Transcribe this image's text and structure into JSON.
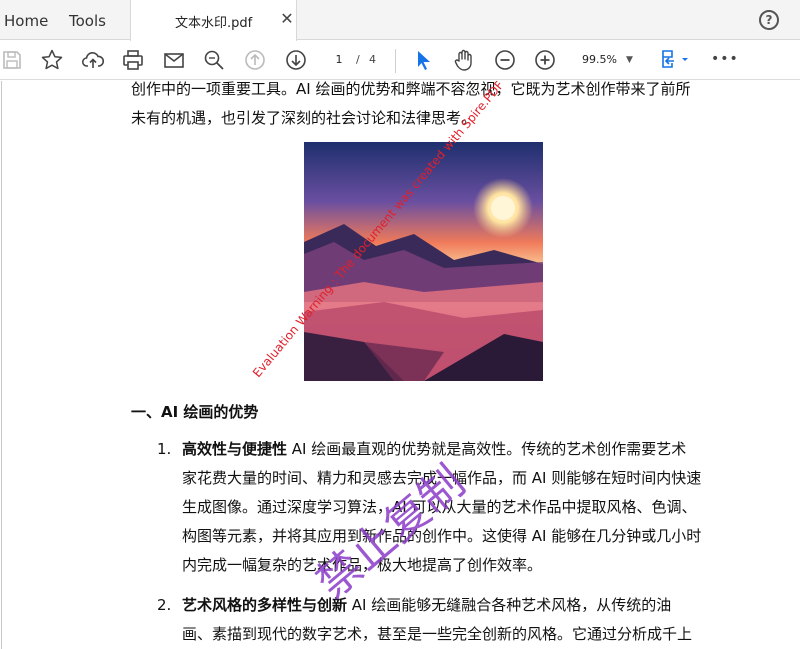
{
  "tabs": {
    "home": "Home",
    "tools": "Tools",
    "document": "文本水印.pdf",
    "close": "✕",
    "help": "?"
  },
  "toolbar": {
    "page_current": "1",
    "page_separator": "/",
    "page_total": "4",
    "zoom": "99.5%",
    "zoom_caret": "▼",
    "more": "•••"
  },
  "document": {
    "intro_lines": [
      "创作中的一项重要工具。AI 绘画的优势和弊端不容忽视，它既为艺术创作带来了前所",
      "未有的机遇，也引发了深刻的社会讨论和法律思考。"
    ],
    "heading": "一、AI 绘画的优势",
    "items": [
      {
        "number": "1.",
        "title": "高效性与便捷性",
        "lines": [
          " AI 绘画最直观的优势就是高效性。传统的艺术创作需要艺术",
          "家花费大量的时间、精力和灵感去完成一幅作品，而 AI 则能够在短时间内快速",
          "生成图像。通过深度学习算法，AI 可以从大量的艺术作品中提取风格、色调、",
          "构图等元素，并将其应用到新作品的创作中。这使得 AI 能够在几分钟或几小时",
          "内完成一幅复杂的艺术作品，极大地提高了创作效率。"
        ]
      },
      {
        "number": "2.",
        "title": "艺术风格的多样性与创新",
        "lines": [
          " AI 绘画能够无缝融合各种艺术风格，从传统的油",
          "画、素描到现代的数字艺术，甚至是一些完全创新的风格。它通过分析成千上"
        ]
      }
    ],
    "watermark_en": "Evaluation Warning : The document was created with Spire.PDF for Python.",
    "watermark_cn": "禁止复制"
  },
  "colors": {
    "accent_blue": "#1473e6",
    "watermark_red": "#e0202a",
    "watermark_purple": "#8a3cc8"
  }
}
